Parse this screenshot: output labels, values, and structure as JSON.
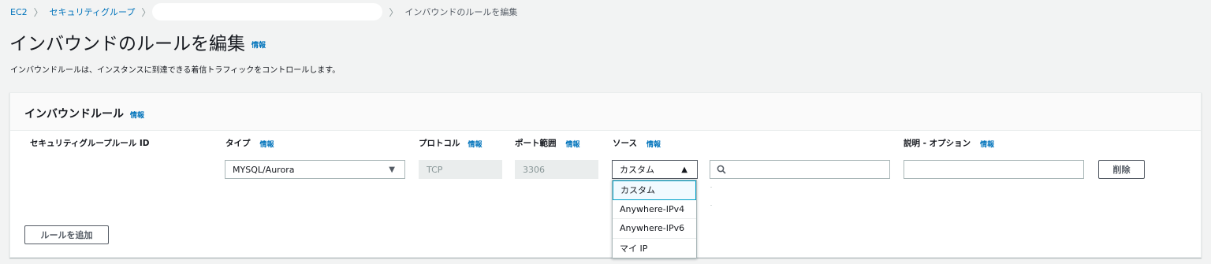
{
  "breadcrumb": {
    "items": [
      "EC2",
      "セキュリティグループ"
    ],
    "current": "インバウンドのルールを編集"
  },
  "page": {
    "title": "インバウンドのルールを編集",
    "info": "情報",
    "description": "インバウンドルールは、インスタンスに到達できる着信トラフィックをコントロールします。"
  },
  "panel": {
    "title": "インバウンドルール",
    "info": "情報"
  },
  "columns": {
    "rule_id": "セキュリティグループルール ID",
    "type": "タイプ",
    "protocol": "プロトコル",
    "port_range": "ポート範囲",
    "source": "ソース",
    "description": "説明 - オプション",
    "info": "情報"
  },
  "rule": {
    "type": "MYSQL/Aurora",
    "protocol": "TCP",
    "port": "3306",
    "source": "カスタム",
    "cidr_value": "",
    "description_value": "",
    "delete_label": "削除"
  },
  "source_options": [
    "カスタム",
    "Anywhere-IPv4",
    "Anywhere-IPv6",
    "マイ IP"
  ],
  "add_rule_label": "ルールを追加"
}
